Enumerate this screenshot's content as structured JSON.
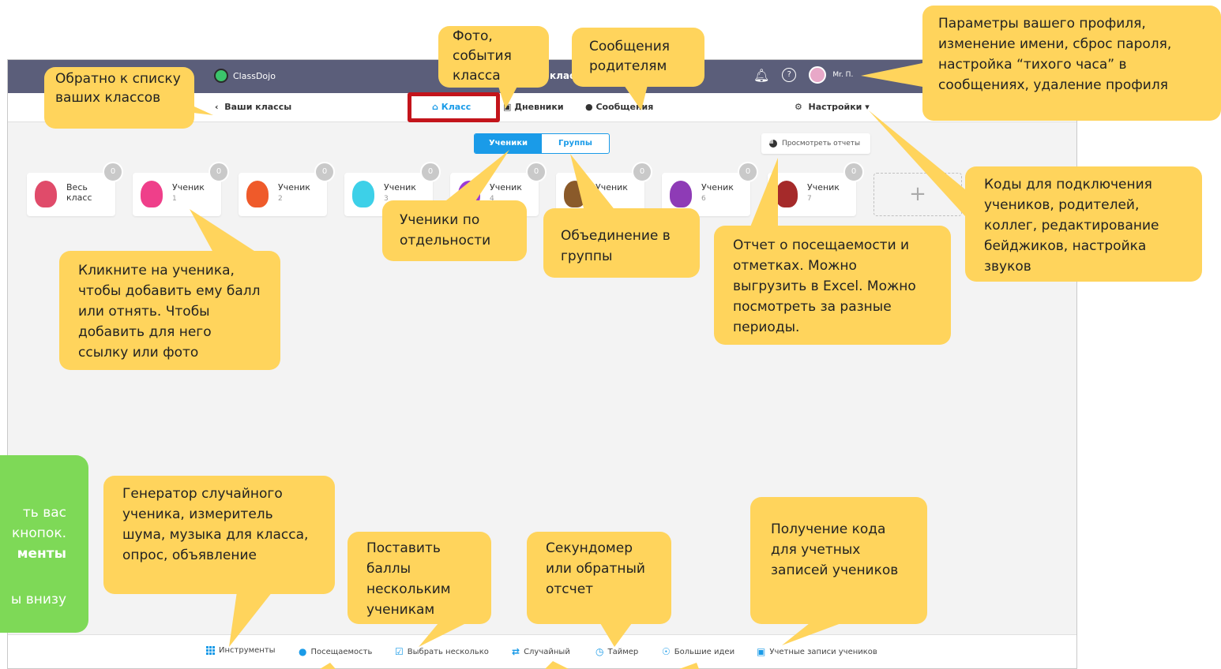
{
  "app": {
    "logo_text": "ClassDojo",
    "center_title": "класс",
    "user_name": "Mr. П.",
    "nav": {
      "back": "Ваши классы",
      "tab_class": "Класс",
      "tab_diaries": "Дневники",
      "tab_messages": "Сообщения",
      "settings": "Настройки"
    },
    "toggle": {
      "students": "Ученики",
      "groups": "Группы"
    },
    "reports_button": "Просмотреть отчеты",
    "cards": [
      {
        "name": "Весь",
        "name2": "класс",
        "num": "",
        "badge": "0",
        "color": "#e04b6a"
      },
      {
        "name": "Ученик",
        "num": "1",
        "badge": "0",
        "color": "#ef3f8a"
      },
      {
        "name": "Ученик",
        "num": "2",
        "badge": "0",
        "color": "#ef5a2a"
      },
      {
        "name": "Ученик",
        "num": "3",
        "badge": "0",
        "color": "#3dd0e8"
      },
      {
        "name": "Ученик",
        "num": "4",
        "badge": "0",
        "color": "#9b3bd6"
      },
      {
        "name": "Ученик",
        "num": "5",
        "badge": "0",
        "color": "#8a5a2a"
      },
      {
        "name": "Ученик",
        "num": "6",
        "badge": "0",
        "color": "#8e3bb6"
      },
      {
        "name": "Ученик",
        "num": "7",
        "badge": "0",
        "color": "#a52a2a"
      }
    ],
    "add_symbol": "+",
    "bottom": {
      "tools": "Инструменты",
      "attendance": "Посещаемость",
      "select_multiple": "Выбрать несколько",
      "random": "Случайный",
      "timer": "Таймер",
      "big_ideas": "Большие идеи",
      "student_accounts": "Учетные записи учеников"
    }
  },
  "callouts": {
    "back": "Обратно к списку ваших классов",
    "photo": "Фото, события класса",
    "messages": "Сообщения родителям",
    "profile": "Параметры вашего профиля, изменение имени, сброс пароля, настройка “тихого часа” в сообщениях, удаление профиля",
    "codes": "Коды для подключения учеников, родителей, коллег, редактирование бейджиков, настройка звуков",
    "individual": "Ученики по отдельности",
    "groups": "Объединение в группы",
    "report": "Отчет о посещаемости и отметках. Можно выгрузить в Excel. Можно посмотреть за разные периоды.",
    "click_student": "Кликните на ученика, чтобы добавить ему балл или отнять. Чтобы добавить для него ссылку или фото",
    "generator": "Генератор случайного ученика, измеритель шума, музыка для класса, опрос, объявление",
    "points_multiple": "Поставить баллы нескольким ученикам",
    "stopwatch": "Секундомер или обратный отсчет",
    "accounts_code": "Получение кода для учетных записей учеников"
  },
  "green_note": {
    "line1": "ть вас",
    "line2": "кнопок.",
    "line3": "менты",
    "line4": "ы внизу"
  }
}
